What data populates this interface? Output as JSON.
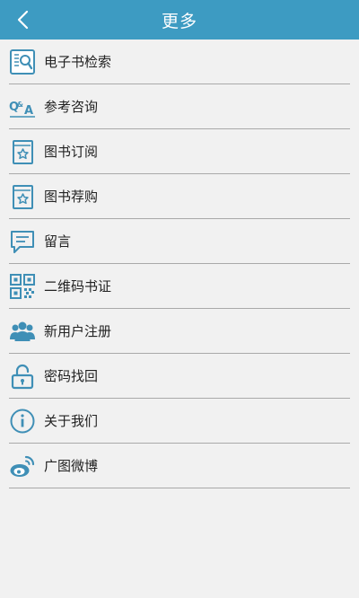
{
  "header": {
    "title": "更多"
  },
  "items": [
    {
      "label": "电子书检索",
      "icon": "ebook-search-icon"
    },
    {
      "label": "参考咨询",
      "icon": "qa-icon"
    },
    {
      "label": "图书订阅",
      "icon": "book-star-icon"
    },
    {
      "label": "图书荐购",
      "icon": "book-star-icon"
    },
    {
      "label": "留言",
      "icon": "message-icon"
    },
    {
      "label": "二维码书证",
      "icon": "qr-code-icon"
    },
    {
      "label": "新用户注册",
      "icon": "users-icon"
    },
    {
      "label": "密码找回",
      "icon": "unlock-icon"
    },
    {
      "label": "关于我们",
      "icon": "info-icon"
    },
    {
      "label": "广图微博",
      "icon": "weibo-icon"
    }
  ],
  "colors": {
    "header": "#3d9bc2",
    "icon": "#3f8fb6",
    "background": "#f1f1f1"
  }
}
